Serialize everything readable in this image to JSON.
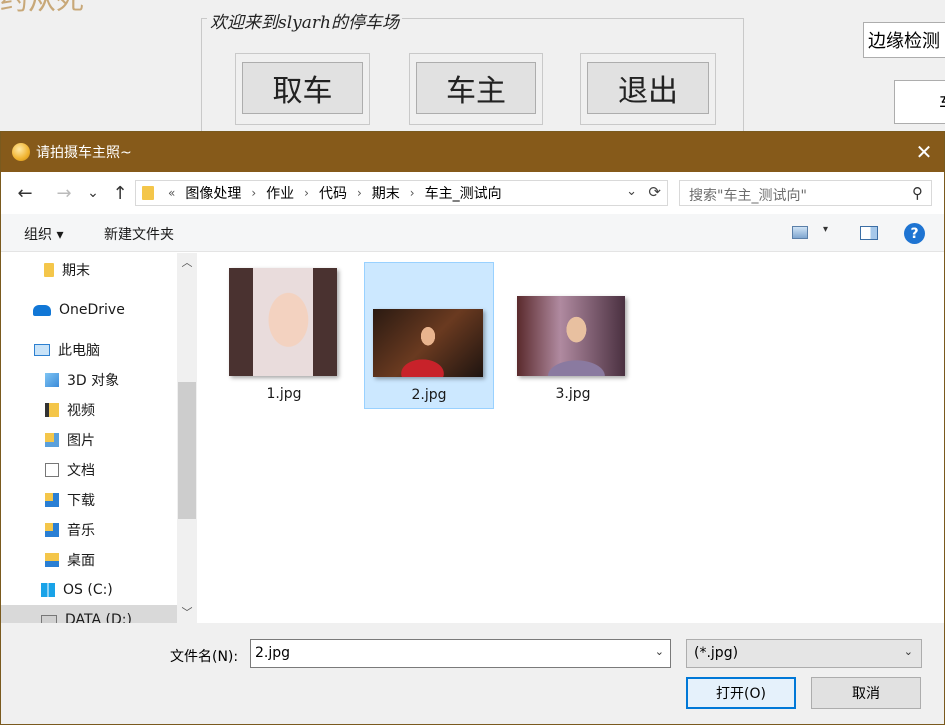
{
  "background": {
    "logo_text": "约从死",
    "group_title": "欢迎来到slyarh的停车场",
    "buttons": [
      "取车",
      "车主",
      "退出"
    ],
    "edge_detect_label": "边缘检测",
    "partial_text": "车"
  },
  "dialog": {
    "title": "请拍摄车主照~",
    "close_glyph": "✕",
    "nav": {
      "back": "←",
      "forward": "→",
      "recent": "⌄",
      "up": "↑"
    },
    "address": {
      "prefix": "«",
      "crumbs": [
        "图像处理",
        "作业",
        "代码",
        "期末",
        "车主_测试向"
      ],
      "chevron": "⌄",
      "refresh": "⟳"
    },
    "search_placeholder": "搜索\"车主_测试向\"",
    "search_icon": "⚲",
    "toolbar": {
      "organize": "组织 ▾",
      "new_folder": "新建文件夹",
      "view_chevron": "▾",
      "help": "?"
    },
    "nav_items": [
      {
        "label": "期末",
        "icon": "folder-icon"
      },
      {
        "label": "OneDrive",
        "icon": "onedrive-icon"
      },
      {
        "label": "此电脑",
        "icon": "pc-icon"
      },
      {
        "label": "3D 对象",
        "icon": "3d-objects-icon"
      },
      {
        "label": "视频",
        "icon": "video-folder-icon"
      },
      {
        "label": "图片",
        "icon": "pictures-folder-icon"
      },
      {
        "label": "文档",
        "icon": "documents-folder-icon"
      },
      {
        "label": "下载",
        "icon": "downloads-folder-icon"
      },
      {
        "label": "音乐",
        "icon": "music-folder-icon"
      },
      {
        "label": "桌面",
        "icon": "desktop-folder-icon"
      },
      {
        "label": "OS (C:)",
        "icon": "os-drive-icon"
      },
      {
        "label": "DATA (D:)",
        "icon": "data-drive-icon"
      }
    ],
    "scroll": {
      "up": "︿",
      "down": "﹀"
    },
    "files": [
      {
        "name": "1.jpg",
        "selected": false
      },
      {
        "name": "2.jpg",
        "selected": true
      },
      {
        "name": "3.jpg",
        "selected": false
      }
    ],
    "filename_label": "文件名(N):",
    "filename_value": "2.jpg",
    "filter_value": "(*.jpg)",
    "dropdown_chevron": "⌄",
    "open_button": "打开(O)",
    "cancel_button": "取消"
  }
}
